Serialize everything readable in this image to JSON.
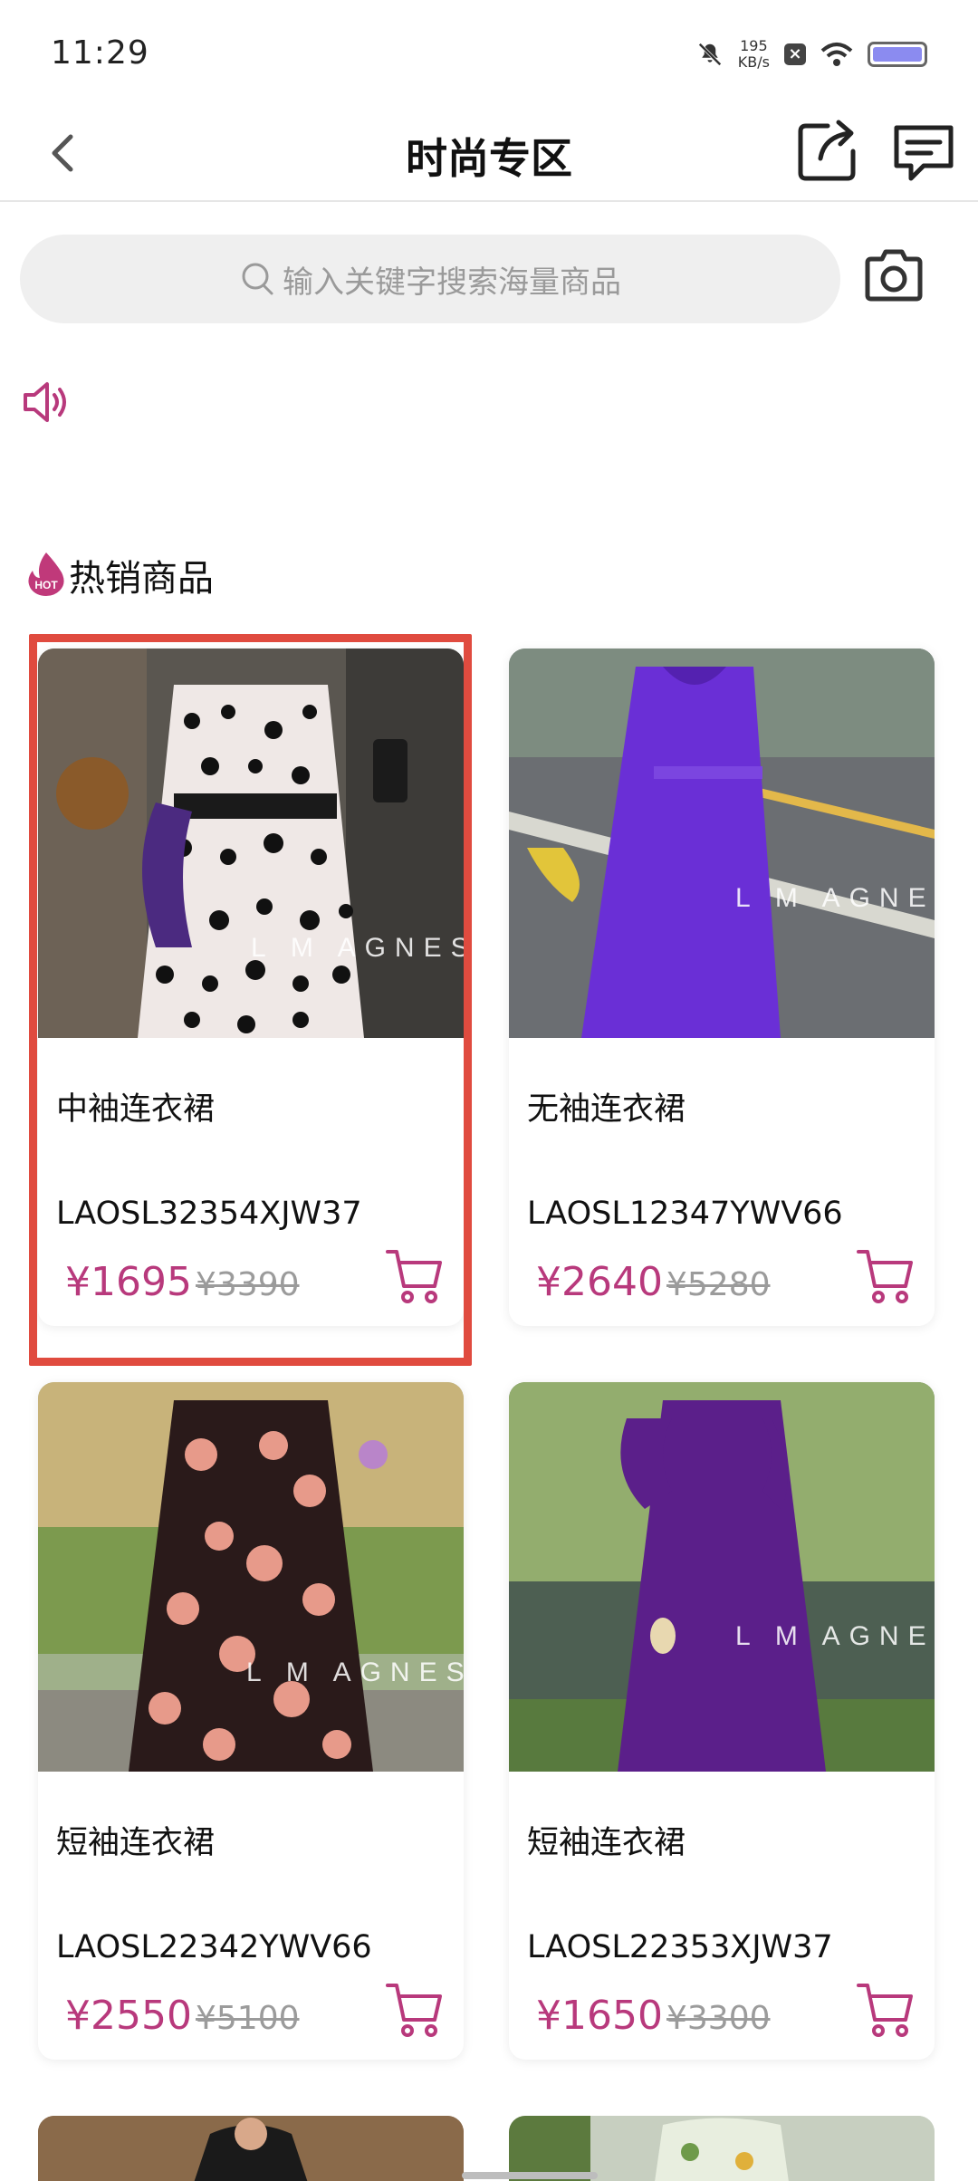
{
  "status_bar": {
    "time": "11:29",
    "net_speed_value": "195",
    "net_speed_unit": "KB/s",
    "box_icon_text": "×"
  },
  "header": {
    "title": "时尚专区"
  },
  "search": {
    "placeholder": "输入关键字搜索海量商品"
  },
  "section": {
    "title": "热销商品",
    "badge": "HOT"
  },
  "products": [
    {
      "name": "中袖连衣裙",
      "code": "LAOSL32354XJW37",
      "price": "¥1695",
      "original_price": "¥3390",
      "watermark": "L M AGNESE",
      "dress_color": "#1a1a1a"
    },
    {
      "name": "无袖连衣裙",
      "code": "LAOSL12347YWV66",
      "price": "¥2640",
      "original_price": "¥5280",
      "watermark": "L M AGNESE",
      "dress_color": "#6a2fd6"
    },
    {
      "name": "短袖连衣裙",
      "code": "LAOSL22342YWV66",
      "price": "¥2550",
      "original_price": "¥5100",
      "watermark": "L M AGNESE",
      "dress_color": "#2a1a1a"
    },
    {
      "name": "短袖连衣裙",
      "code": "LAOSL22353XJW37",
      "price": "¥1650",
      "original_price": "¥3300",
      "watermark": "L M AGNESE",
      "dress_color": "#5b1f8a"
    }
  ],
  "colors": {
    "accent": "#b8397c",
    "highlight_border": "#e04b3f"
  }
}
